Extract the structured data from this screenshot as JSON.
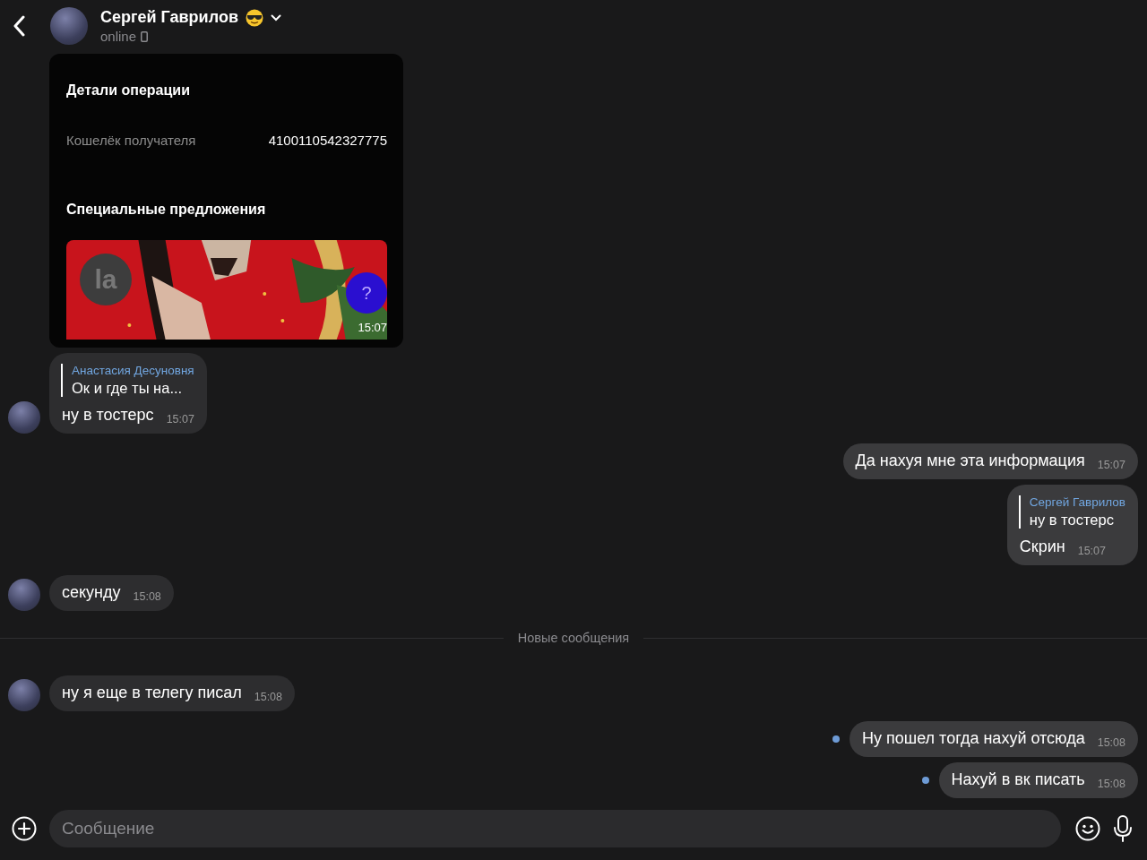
{
  "header": {
    "name": "Сергей Гаврилов",
    "status": "online"
  },
  "messages": [
    {
      "kind": "screenshot",
      "avatar": false,
      "title": "Детали операции",
      "field_label": "Кошелёк получателя",
      "field_value": "4100110542327775",
      "section": "Специальные предложения",
      "logo": "la",
      "help": "?",
      "time": "15:07"
    },
    {
      "kind": "incoming",
      "avatar": true,
      "reply": {
        "author": "Анастасия Десуновня",
        "text": "Ок и где ты на..."
      },
      "text": "ну в тостерс",
      "time": "15:07"
    },
    {
      "kind": "outgoing",
      "unread": false,
      "text": "Да нахуя мне эта информация",
      "time": "15:07"
    },
    {
      "kind": "outgoing",
      "unread": false,
      "reply": {
        "author": "Сергей Гаврилов",
        "text": "ну в тостерс"
      },
      "text": "Скрин",
      "time": "15:07"
    },
    {
      "kind": "incoming",
      "avatar": true,
      "text": "секунду",
      "time": "15:08"
    },
    {
      "kind": "divider",
      "text": "Новые сообщения"
    },
    {
      "kind": "incoming",
      "avatar": true,
      "text": "ну я еще в телегу писал",
      "time": "15:08"
    },
    {
      "kind": "outgoing",
      "unread": true,
      "text": "Ну пошел тогда нахуй отсюда",
      "time": "15:08"
    },
    {
      "kind": "outgoing",
      "unread": true,
      "text": "Нахуй в вк писать",
      "time": "15:08"
    }
  ],
  "composer": {
    "placeholder": "Сообщение"
  }
}
